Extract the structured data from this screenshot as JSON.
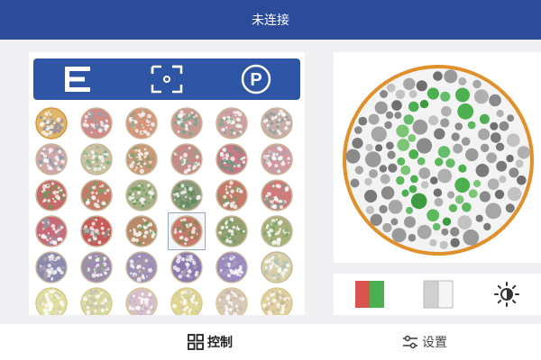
{
  "header": {
    "title": "未连接"
  },
  "toolbar": {
    "buttons": [
      {
        "name": "e-chart-icon"
      },
      {
        "name": "target-square-icon"
      },
      {
        "name": "parking-p-icon",
        "label": "P"
      }
    ]
  },
  "plates": {
    "rows": [
      [
        {
          "bg": "#e0b56c",
          "dot": "#8f8fa8",
          "ring": "#d9963a"
        },
        {
          "bg": "#d28a86",
          "dot": "#9aa0a8",
          "ring": "#c8b89a"
        },
        {
          "bg": "#d8957a",
          "dot": "#8fa38a",
          "ring": "#c8b89a"
        },
        {
          "bg": "#c89a92",
          "dot": "#6aa68e",
          "ring": "#c8b89a"
        },
        {
          "bg": "#cfa0a2",
          "dot": "#7da88a",
          "ring": "#c8b89a"
        },
        {
          "bg": "#c8b0a8",
          "dot": "#8a9aa0",
          "ring": "#c8b89a"
        }
      ],
      [
        {
          "bg": "#d0a8a8",
          "dot": "#8aa0b0",
          "ring": "#c8b89a"
        },
        {
          "bg": "#c8c0a0",
          "dot": "#7fae8a",
          "ring": "#c8b89a"
        },
        {
          "bg": "#c89a78",
          "dot": "#8a9a70",
          "ring": "#c8b89a"
        },
        {
          "bg": "#c88a88",
          "dot": "#8aa88a",
          "ring": "#c8b89a"
        },
        {
          "bg": "#c87a8a",
          "dot": "#6a9a7a",
          "ring": "#c8b89a"
        },
        {
          "bg": "#d09aa0",
          "dot": "#a0a8b0",
          "ring": "#c8b89a"
        }
      ],
      [
        {
          "bg": "#c86a6a",
          "dot": "#6a9a5a",
          "ring": "#c8b89a"
        },
        {
          "bg": "#c87a6a",
          "dot": "#7aa06a",
          "ring": "#c8b89a"
        },
        {
          "bg": "#a8b08a",
          "dot": "#6a9a5a",
          "ring": "#c8b89a"
        },
        {
          "bg": "#889a7a",
          "dot": "#5a8a5a",
          "ring": "#c8b89a"
        },
        {
          "bg": "#c87a6a",
          "dot": "#7a9a6a",
          "ring": "#c8b89a"
        },
        {
          "bg": "#d07a7a",
          "dot": "#8a9a8a",
          "ring": "#c8b89a"
        }
      ],
      [
        {
          "bg": "#c86a7a",
          "dot": "#8a9aa8",
          "ring": "#c8b89a"
        },
        {
          "bg": "#c85a5a",
          "dot": "#7a9a8a",
          "ring": "#c8b89a"
        },
        {
          "bg": "#b88a6a",
          "dot": "#6a9a5a",
          "ring": "#c8b89a"
        },
        {
          "bg": "#c87a6a",
          "dot": "#7a8a5a",
          "ring": "#c8b89a"
        },
        {
          "bg": "#98a070",
          "dot": "#6a9a6a",
          "ring": "#c8b89a"
        },
        {
          "bg": "#a8b07a",
          "dot": "#7aa06a",
          "ring": "#c8b89a"
        }
      ],
      [
        {
          "bg": "#8a8ab0",
          "dot": "#b0a0a8",
          "ring": "#c8b89a"
        },
        {
          "bg": "#a08ab0",
          "dot": "#8aa08a",
          "ring": "#c8b89a"
        },
        {
          "bg": "#9a90b8",
          "dot": "#b09aa0",
          "ring": "#c8b89a"
        },
        {
          "bg": "#8a7ab0",
          "dot": "#a89ab8",
          "ring": "#c8b89a"
        },
        {
          "bg": "#9a8ac0",
          "dot": "#a8a0c0",
          "ring": "#c8b89a"
        },
        {
          "bg": "#d8d0a8",
          "dot": "#b0c0b8",
          "ring": "#c8b89a"
        }
      ],
      [
        {
          "bg": "#e0e0a0",
          "dot": "#d0c8b0",
          "ring": "#d8c890"
        },
        {
          "bg": "#d8d8a0",
          "dot": "#c8c0b0",
          "ring": "#d8c890"
        },
        {
          "bg": "#d8c0c8",
          "dot": "#b8b0c8",
          "ring": "#d8c890"
        },
        {
          "bg": "#e0d890",
          "dot": "#d0c8a8",
          "ring": "#d8c890"
        },
        {
          "bg": "#d8c8b8",
          "dot": "#c8b8a8",
          "ring": "#d8c890"
        },
        {
          "bg": "#e0d0a0",
          "dot": "#c8b898",
          "ring": "#d8c890"
        }
      ]
    ],
    "selected": {
      "row": 3,
      "col": 3
    }
  },
  "large_plate": {
    "ring": "#e0902a",
    "bg_colors": [
      "#8a8a8a",
      "#9a9a9a",
      "#6f6f6f",
      "#b0b0b0",
      "#7a7a7a",
      "#a6a6a6",
      "#c2c2c2"
    ],
    "fg_colors": [
      "#4caf50",
      "#66bb6a",
      "#3d9a40",
      "#7cc576",
      "#5cb85c"
    ]
  },
  "bottom_controls": [
    {
      "name": "red-green-color-button",
      "colors": [
        "#d9534f",
        "#4caf50"
      ]
    },
    {
      "name": "gray-white-color-button",
      "colors": [
        "#d0d0d0",
        "#f5f5f5"
      ]
    },
    {
      "name": "brightness-icon"
    }
  ],
  "tabs": [
    {
      "label": "控制",
      "icon": "grid-icon",
      "active": true
    },
    {
      "label": "设置",
      "icon": "sliders-icon",
      "active": false
    }
  ]
}
